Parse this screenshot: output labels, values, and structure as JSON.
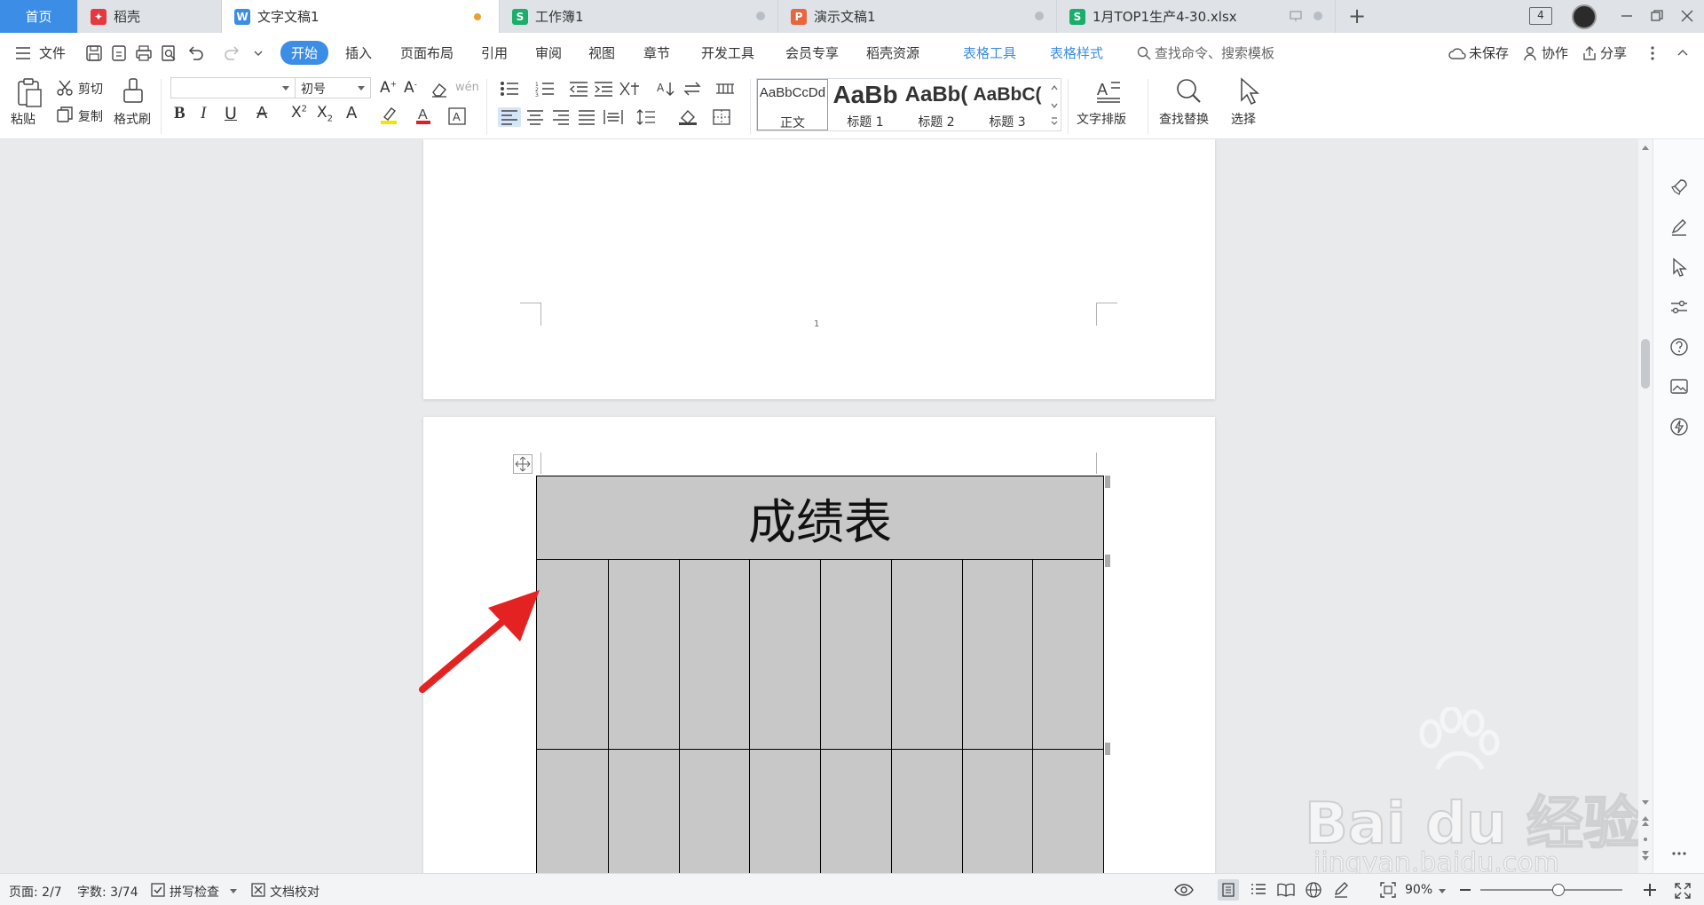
{
  "tabs": {
    "home": "首页",
    "docer": "稻壳",
    "doc1": "文字文稿1",
    "book1": "工作簿1",
    "ppt1": "演示文稿1",
    "xlsx": "1月TOP1生产4-30.xlsx",
    "window_count": "4",
    "icon_colors": {
      "docer": "#e6393f",
      "writer": "#3c8de6",
      "sheet": "#1aae6a",
      "ppt": "#e8663d"
    }
  },
  "menubar": {
    "file": "文件",
    "items": [
      "开始",
      "插入",
      "页面布局",
      "引用",
      "审阅",
      "视图",
      "章节",
      "开发工具",
      "会员专享",
      "稻壳资源"
    ],
    "context_tabs": [
      "表格工具",
      "表格样式"
    ],
    "search_placeholder": "查找命令、搜索模板",
    "unsaved": "未保存",
    "collab": "协作",
    "share": "分享",
    "accent": "#3c8de6"
  },
  "ribbon": {
    "paste": "粘贴",
    "cut": "剪切",
    "copy": "复制",
    "format_painter": "格式刷",
    "font_name": "",
    "font_size": "初号",
    "styles": [
      {
        "preview": "AaBbCcDd",
        "name": "正文"
      },
      {
        "preview": "AaBb",
        "name": "标题 1"
      },
      {
        "preview": "AaBb(",
        "name": "标题 2"
      },
      {
        "preview": "AaBbC(",
        "name": "标题 3"
      }
    ],
    "text_layout": "文字排版",
    "find_replace": "查找替换",
    "select": "选择"
  },
  "document": {
    "page1_number": "1",
    "table_title": "成绩表",
    "columns": 8
  },
  "watermark": {
    "brand": "Bai du 经验",
    "url": "jingyan.baidu.com"
  },
  "statusbar": {
    "page": "页面: 2/7",
    "words": "字数: 3/74",
    "spell": "拼写检查",
    "proof": "文档校对",
    "zoom": "90%",
    "zoom_fraction": 0.55
  }
}
